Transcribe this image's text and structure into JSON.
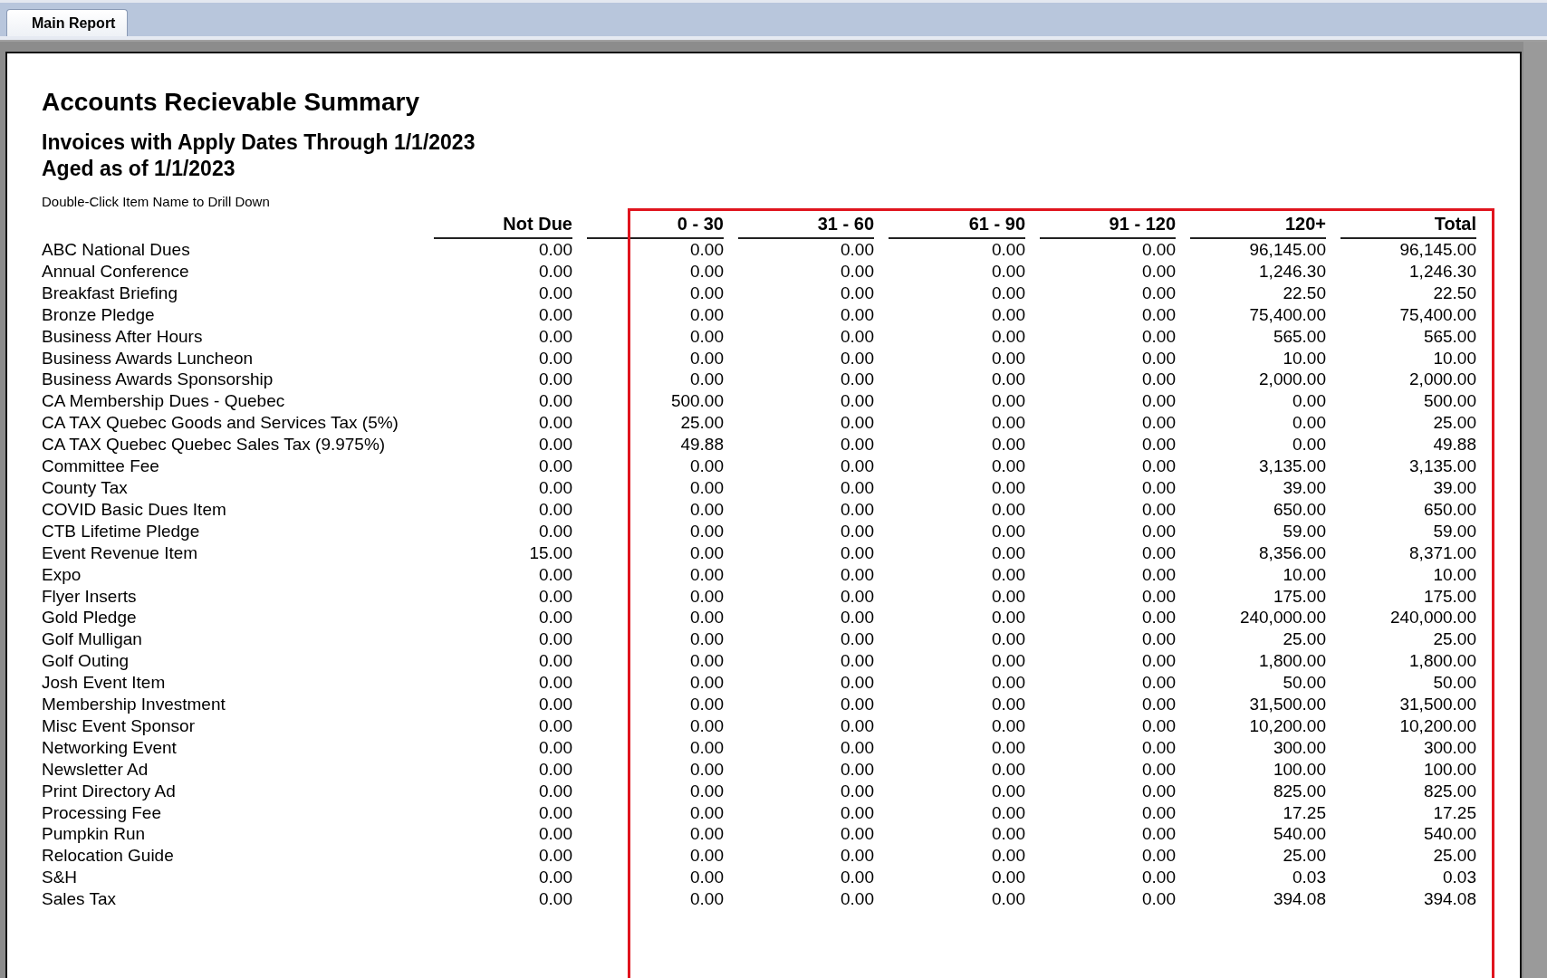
{
  "tabs": [
    {
      "label": "Main Report",
      "selected": true
    }
  ],
  "report": {
    "title": "Accounts Recievable Summary",
    "subtitle_lines": [
      "Invoices with Apply Dates Through 1/1/2023",
      "Aged as of 1/1/2023"
    ],
    "hint": "Double-Click Item Name to Drill Down",
    "columns": [
      "Not Due",
      "0 - 30",
      "31 - 60",
      "61 - 90",
      "91 - 120",
      "120+",
      "Total"
    ],
    "rows": [
      {
        "item": "ABC National Dues",
        "values": [
          "0.00",
          "0.00",
          "0.00",
          "0.00",
          "0.00",
          "96,145.00",
          "96,145.00"
        ]
      },
      {
        "item": "Annual Conference",
        "values": [
          "0.00",
          "0.00",
          "0.00",
          "0.00",
          "0.00",
          "1,246.30",
          "1,246.30"
        ]
      },
      {
        "item": "Breakfast Briefing",
        "values": [
          "0.00",
          "0.00",
          "0.00",
          "0.00",
          "0.00",
          "22.50",
          "22.50"
        ]
      },
      {
        "item": "Bronze Pledge",
        "values": [
          "0.00",
          "0.00",
          "0.00",
          "0.00",
          "0.00",
          "75,400.00",
          "75,400.00"
        ]
      },
      {
        "item": "Business After Hours",
        "values": [
          "0.00",
          "0.00",
          "0.00",
          "0.00",
          "0.00",
          "565.00",
          "565.00"
        ]
      },
      {
        "item": "Business Awards Luncheon",
        "values": [
          "0.00",
          "0.00",
          "0.00",
          "0.00",
          "0.00",
          "10.00",
          "10.00"
        ]
      },
      {
        "item": "Business Awards Sponsorship",
        "values": [
          "0.00",
          "0.00",
          "0.00",
          "0.00",
          "0.00",
          "2,000.00",
          "2,000.00"
        ]
      },
      {
        "item": "CA Membership Dues - Quebec",
        "values": [
          "0.00",
          "500.00",
          "0.00",
          "0.00",
          "0.00",
          "0.00",
          "500.00"
        ]
      },
      {
        "item": "CA TAX Quebec Goods and Services Tax (5%)",
        "values": [
          "0.00",
          "25.00",
          "0.00",
          "0.00",
          "0.00",
          "0.00",
          "25.00"
        ]
      },
      {
        "item": "CA TAX Quebec Quebec Sales Tax (9.975%)",
        "values": [
          "0.00",
          "49.88",
          "0.00",
          "0.00",
          "0.00",
          "0.00",
          "49.88"
        ]
      },
      {
        "item": "Committee Fee",
        "values": [
          "0.00",
          "0.00",
          "0.00",
          "0.00",
          "0.00",
          "3,135.00",
          "3,135.00"
        ]
      },
      {
        "item": "County Tax",
        "values": [
          "0.00",
          "0.00",
          "0.00",
          "0.00",
          "0.00",
          "39.00",
          "39.00"
        ]
      },
      {
        "item": "COVID Basic Dues Item",
        "values": [
          "0.00",
          "0.00",
          "0.00",
          "0.00",
          "0.00",
          "650.00",
          "650.00"
        ]
      },
      {
        "item": "CTB Lifetime Pledge",
        "values": [
          "0.00",
          "0.00",
          "0.00",
          "0.00",
          "0.00",
          "59.00",
          "59.00"
        ]
      },
      {
        "item": "Event Revenue Item",
        "values": [
          "15.00",
          "0.00",
          "0.00",
          "0.00",
          "0.00",
          "8,356.00",
          "8,371.00"
        ]
      },
      {
        "item": "Expo",
        "values": [
          "0.00",
          "0.00",
          "0.00",
          "0.00",
          "0.00",
          "10.00",
          "10.00"
        ]
      },
      {
        "item": "Flyer Inserts",
        "values": [
          "0.00",
          "0.00",
          "0.00",
          "0.00",
          "0.00",
          "175.00",
          "175.00"
        ]
      },
      {
        "item": "Gold Pledge",
        "values": [
          "0.00",
          "0.00",
          "0.00",
          "0.00",
          "0.00",
          "240,000.00",
          "240,000.00"
        ]
      },
      {
        "item": "Golf Mulligan",
        "values": [
          "0.00",
          "0.00",
          "0.00",
          "0.00",
          "0.00",
          "25.00",
          "25.00"
        ]
      },
      {
        "item": "Golf Outing",
        "values": [
          "0.00",
          "0.00",
          "0.00",
          "0.00",
          "0.00",
          "1,800.00",
          "1,800.00"
        ]
      },
      {
        "item": "Josh Event Item",
        "values": [
          "0.00",
          "0.00",
          "0.00",
          "0.00",
          "0.00",
          "50.00",
          "50.00"
        ]
      },
      {
        "item": "Membership Investment",
        "values": [
          "0.00",
          "0.00",
          "0.00",
          "0.00",
          "0.00",
          "31,500.00",
          "31,500.00"
        ]
      },
      {
        "item": "Misc Event Sponsor",
        "values": [
          "0.00",
          "0.00",
          "0.00",
          "0.00",
          "0.00",
          "10,200.00",
          "10,200.00"
        ]
      },
      {
        "item": "Networking Event",
        "values": [
          "0.00",
          "0.00",
          "0.00",
          "0.00",
          "0.00",
          "300.00",
          "300.00"
        ]
      },
      {
        "item": "Newsletter Ad",
        "values": [
          "0.00",
          "0.00",
          "0.00",
          "0.00",
          "0.00",
          "100.00",
          "100.00"
        ]
      },
      {
        "item": "Print Directory Ad",
        "values": [
          "0.00",
          "0.00",
          "0.00",
          "0.00",
          "0.00",
          "825.00",
          "825.00"
        ]
      },
      {
        "item": "Processing Fee",
        "values": [
          "0.00",
          "0.00",
          "0.00",
          "0.00",
          "0.00",
          "17.25",
          "17.25"
        ]
      },
      {
        "item": "Pumpkin Run",
        "values": [
          "0.00",
          "0.00",
          "0.00",
          "0.00",
          "0.00",
          "540.00",
          "540.00"
        ]
      },
      {
        "item": "Relocation Guide",
        "values": [
          "0.00",
          "0.00",
          "0.00",
          "0.00",
          "0.00",
          "25.00",
          "25.00"
        ]
      },
      {
        "item": "S&H",
        "values": [
          "0.00",
          "0.00",
          "0.00",
          "0.00",
          "0.00",
          "0.03",
          "0.03"
        ]
      },
      {
        "item": "Sales Tax",
        "values": [
          "0.00",
          "0.00",
          "0.00",
          "0.00",
          "0.00",
          "394.08",
          "394.08"
        ]
      }
    ]
  }
}
